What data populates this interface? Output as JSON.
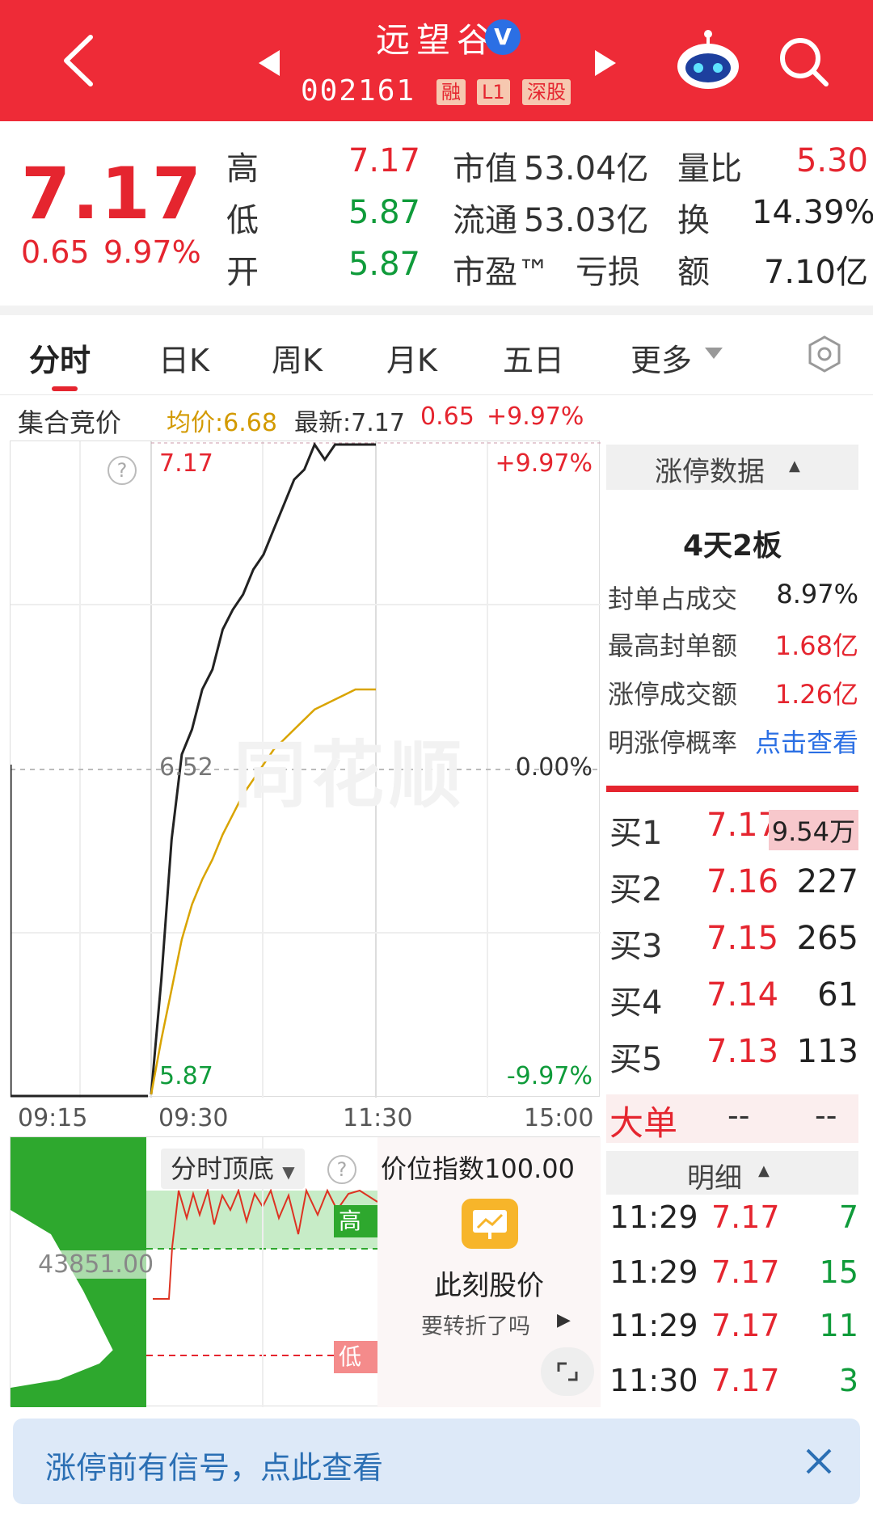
{
  "header": {
    "title": "远望谷",
    "verified_mark": "V",
    "code": "002161",
    "badges": [
      "融",
      "L1",
      "深股"
    ],
    "icons": [
      "back-icon",
      "prev-stock-icon",
      "next-stock-icon",
      "robot-icon",
      "search-icon"
    ]
  },
  "quote": {
    "price": "7.17",
    "change": "0.65",
    "change_pct": "9.97%",
    "stats": [
      {
        "label": "高",
        "value": "7.17",
        "color": "red"
      },
      {
        "label": "低",
        "value": "5.87",
        "color": "green"
      },
      {
        "label": "开",
        "value": "5.87",
        "color": "green"
      }
    ],
    "market_cap_label": "市值",
    "market_cap": "53.04亿",
    "float_cap_label": "流通",
    "float_cap": "53.03亿",
    "pe_label": "市盈™",
    "pe": "亏损",
    "vol_ratio_label": "量比",
    "vol_ratio": "5.30",
    "turnover_label": "换",
    "turnover": "14.39%",
    "amount_label": "额",
    "amount": "7.10亿"
  },
  "tabs": [
    "分时",
    "日K",
    "周K",
    "月K",
    "五日",
    "更多"
  ],
  "tabs_active": 0,
  "info_bar": {
    "auction": "集合竞价",
    "avg": "均价:6.68",
    "latest": "最新:7.17",
    "change": "0.65",
    "pct": "+9.97%"
  },
  "chart": {
    "price_high": "7.17",
    "price_mid": "6.52",
    "price_low": "5.87",
    "pct_high": "+9.97%",
    "pct_mid": "0.00%",
    "pct_low": "-9.97%",
    "watermark": "同花顺",
    "x_ticks": [
      "09:15",
      "09:30",
      "11:30",
      "15:00"
    ],
    "help": "?"
  },
  "chart_data": {
    "type": "line",
    "ylim": [
      5.87,
      7.17
    ],
    "x": [
      "09:30",
      "09:33",
      "09:36",
      "09:40",
      "09:45",
      "09:50",
      "09:55",
      "10:00",
      "10:05",
      "10:10",
      "10:15",
      "10:20",
      "10:25",
      "10:30",
      "10:35",
      "10:40",
      "10:45",
      "10:50",
      "10:55",
      "11:00",
      "11:10",
      "11:20",
      "11:30"
    ],
    "series": [
      {
        "values": [
          5.87,
          6.1,
          6.38,
          6.55,
          6.6,
          6.68,
          6.72,
          6.8,
          6.84,
          6.87,
          6.92,
          6.95,
          7.0,
          7.05,
          7.1,
          7.12,
          7.17,
          7.14,
          7.17,
          7.17,
          7.17,
          7.17,
          7.17
        ]
      },
      {
        "values": [
          5.87,
          5.98,
          6.08,
          6.18,
          6.25,
          6.3,
          6.34,
          6.39,
          6.43,
          6.47,
          6.5,
          6.53,
          6.56,
          6.58,
          6.6,
          6.62,
          6.64,
          6.65,
          6.66,
          6.67,
          6.68,
          6.68,
          6.68
        ]
      }
    ]
  },
  "subchart": {
    "value": "43851.00",
    "indicator": "分时顶底",
    "high_label": "高",
    "low_label": "低",
    "price_index": "价位指数100.00",
    "promo_title": "此刻股价",
    "promo_sub": "要转折了吗"
  },
  "right_panel": {
    "header": "涨停数据",
    "boards": "4天2板",
    "rows": [
      {
        "label": "封单占成交",
        "value": "8.97%",
        "color": "dark"
      },
      {
        "label": "最高封单额",
        "value": "1.68亿",
        "color": "red"
      },
      {
        "label": "涨停成交额",
        "value": "1.26亿",
        "color": "red"
      },
      {
        "label": "明涨停概率",
        "value": "点击查看",
        "color": "blue"
      }
    ],
    "order_book": [
      {
        "label": "买1",
        "price": "7.17",
        "volume": "9.54万"
      },
      {
        "label": "买2",
        "price": "7.16",
        "volume": "227"
      },
      {
        "label": "买3",
        "price": "7.15",
        "volume": "265"
      },
      {
        "label": "买4",
        "price": "7.14",
        "volume": "61"
      },
      {
        "label": "买5",
        "price": "7.13",
        "volume": "113"
      }
    ],
    "big_order_label": "大单",
    "big_order_a": "--",
    "big_order_b": "--",
    "detail_header": "明细",
    "details": [
      {
        "time": "11:29",
        "price": "7.17",
        "vol": "7"
      },
      {
        "time": "11:29",
        "price": "7.17",
        "vol": "15"
      },
      {
        "time": "11:29",
        "price": "7.17",
        "vol": "11"
      },
      {
        "time": "11:30",
        "price": "7.17",
        "vol": "3"
      }
    ]
  },
  "banner": {
    "text": "涨停前有信号，点此查看"
  },
  "colors": {
    "header_red": "#ee2b37",
    "up_red": "#e5252f",
    "down_green": "#0f9b3a",
    "avg_line": "#d9a400",
    "link_blue": "#2b6fe4"
  }
}
